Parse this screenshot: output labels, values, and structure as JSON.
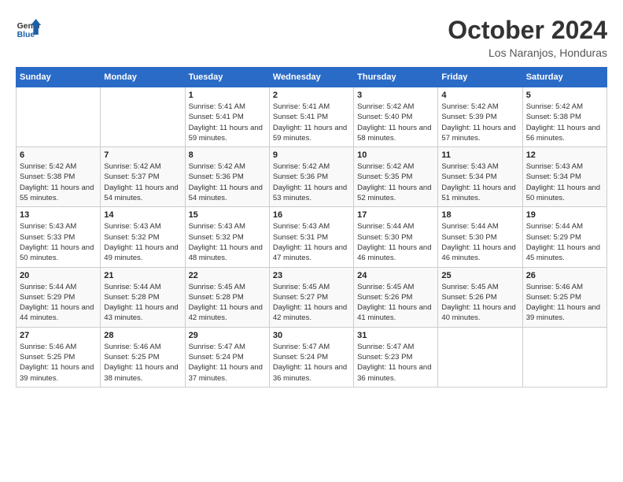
{
  "header": {
    "logo": {
      "general": "General",
      "blue": "Blue"
    },
    "title": "October 2024",
    "location": "Los Naranjos, Honduras"
  },
  "weekdays": [
    "Sunday",
    "Monday",
    "Tuesday",
    "Wednesday",
    "Thursday",
    "Friday",
    "Saturday"
  ],
  "days": [
    {
      "num": "",
      "sunrise": "",
      "sunset": "",
      "daylight": ""
    },
    {
      "num": "",
      "sunrise": "",
      "sunset": "",
      "daylight": ""
    },
    {
      "num": "1",
      "sunrise": "Sunrise: 5:41 AM",
      "sunset": "Sunset: 5:41 PM",
      "daylight": "Daylight: 11 hours and 59 minutes."
    },
    {
      "num": "2",
      "sunrise": "Sunrise: 5:41 AM",
      "sunset": "Sunset: 5:41 PM",
      "daylight": "Daylight: 11 hours and 59 minutes."
    },
    {
      "num": "3",
      "sunrise": "Sunrise: 5:42 AM",
      "sunset": "Sunset: 5:40 PM",
      "daylight": "Daylight: 11 hours and 58 minutes."
    },
    {
      "num": "4",
      "sunrise": "Sunrise: 5:42 AM",
      "sunset": "Sunset: 5:39 PM",
      "daylight": "Daylight: 11 hours and 57 minutes."
    },
    {
      "num": "5",
      "sunrise": "Sunrise: 5:42 AM",
      "sunset": "Sunset: 5:38 PM",
      "daylight": "Daylight: 11 hours and 56 minutes."
    },
    {
      "num": "6",
      "sunrise": "Sunrise: 5:42 AM",
      "sunset": "Sunset: 5:38 PM",
      "daylight": "Daylight: 11 hours and 55 minutes."
    },
    {
      "num": "7",
      "sunrise": "Sunrise: 5:42 AM",
      "sunset": "Sunset: 5:37 PM",
      "daylight": "Daylight: 11 hours and 54 minutes."
    },
    {
      "num": "8",
      "sunrise": "Sunrise: 5:42 AM",
      "sunset": "Sunset: 5:36 PM",
      "daylight": "Daylight: 11 hours and 54 minutes."
    },
    {
      "num": "9",
      "sunrise": "Sunrise: 5:42 AM",
      "sunset": "Sunset: 5:36 PM",
      "daylight": "Daylight: 11 hours and 53 minutes."
    },
    {
      "num": "10",
      "sunrise": "Sunrise: 5:42 AM",
      "sunset": "Sunset: 5:35 PM",
      "daylight": "Daylight: 11 hours and 52 minutes."
    },
    {
      "num": "11",
      "sunrise": "Sunrise: 5:43 AM",
      "sunset": "Sunset: 5:34 PM",
      "daylight": "Daylight: 11 hours and 51 minutes."
    },
    {
      "num": "12",
      "sunrise": "Sunrise: 5:43 AM",
      "sunset": "Sunset: 5:34 PM",
      "daylight": "Daylight: 11 hours and 50 minutes."
    },
    {
      "num": "13",
      "sunrise": "Sunrise: 5:43 AM",
      "sunset": "Sunset: 5:33 PM",
      "daylight": "Daylight: 11 hours and 50 minutes."
    },
    {
      "num": "14",
      "sunrise": "Sunrise: 5:43 AM",
      "sunset": "Sunset: 5:32 PM",
      "daylight": "Daylight: 11 hours and 49 minutes."
    },
    {
      "num": "15",
      "sunrise": "Sunrise: 5:43 AM",
      "sunset": "Sunset: 5:32 PM",
      "daylight": "Daylight: 11 hours and 48 minutes."
    },
    {
      "num": "16",
      "sunrise": "Sunrise: 5:43 AM",
      "sunset": "Sunset: 5:31 PM",
      "daylight": "Daylight: 11 hours and 47 minutes."
    },
    {
      "num": "17",
      "sunrise": "Sunrise: 5:44 AM",
      "sunset": "Sunset: 5:30 PM",
      "daylight": "Daylight: 11 hours and 46 minutes."
    },
    {
      "num": "18",
      "sunrise": "Sunrise: 5:44 AM",
      "sunset": "Sunset: 5:30 PM",
      "daylight": "Daylight: 11 hours and 46 minutes."
    },
    {
      "num": "19",
      "sunrise": "Sunrise: 5:44 AM",
      "sunset": "Sunset: 5:29 PM",
      "daylight": "Daylight: 11 hours and 45 minutes."
    },
    {
      "num": "20",
      "sunrise": "Sunrise: 5:44 AM",
      "sunset": "Sunset: 5:29 PM",
      "daylight": "Daylight: 11 hours and 44 minutes."
    },
    {
      "num": "21",
      "sunrise": "Sunrise: 5:44 AM",
      "sunset": "Sunset: 5:28 PM",
      "daylight": "Daylight: 11 hours and 43 minutes."
    },
    {
      "num": "22",
      "sunrise": "Sunrise: 5:45 AM",
      "sunset": "Sunset: 5:28 PM",
      "daylight": "Daylight: 11 hours and 42 minutes."
    },
    {
      "num": "23",
      "sunrise": "Sunrise: 5:45 AM",
      "sunset": "Sunset: 5:27 PM",
      "daylight": "Daylight: 11 hours and 42 minutes."
    },
    {
      "num": "24",
      "sunrise": "Sunrise: 5:45 AM",
      "sunset": "Sunset: 5:26 PM",
      "daylight": "Daylight: 11 hours and 41 minutes."
    },
    {
      "num": "25",
      "sunrise": "Sunrise: 5:45 AM",
      "sunset": "Sunset: 5:26 PM",
      "daylight": "Daylight: 11 hours and 40 minutes."
    },
    {
      "num": "26",
      "sunrise": "Sunrise: 5:46 AM",
      "sunset": "Sunset: 5:25 PM",
      "daylight": "Daylight: 11 hours and 39 minutes."
    },
    {
      "num": "27",
      "sunrise": "Sunrise: 5:46 AM",
      "sunset": "Sunset: 5:25 PM",
      "daylight": "Daylight: 11 hours and 39 minutes."
    },
    {
      "num": "28",
      "sunrise": "Sunrise: 5:46 AM",
      "sunset": "Sunset: 5:25 PM",
      "daylight": "Daylight: 11 hours and 38 minutes."
    },
    {
      "num": "29",
      "sunrise": "Sunrise: 5:47 AM",
      "sunset": "Sunset: 5:24 PM",
      "daylight": "Daylight: 11 hours and 37 minutes."
    },
    {
      "num": "30",
      "sunrise": "Sunrise: 5:47 AM",
      "sunset": "Sunset: 5:24 PM",
      "daylight": "Daylight: 11 hours and 36 minutes."
    },
    {
      "num": "31",
      "sunrise": "Sunrise: 5:47 AM",
      "sunset": "Sunset: 5:23 PM",
      "daylight": "Daylight: 11 hours and 36 minutes."
    },
    {
      "num": "",
      "sunrise": "",
      "sunset": "",
      "daylight": ""
    },
    {
      "num": "",
      "sunrise": "",
      "sunset": "",
      "daylight": ""
    }
  ]
}
